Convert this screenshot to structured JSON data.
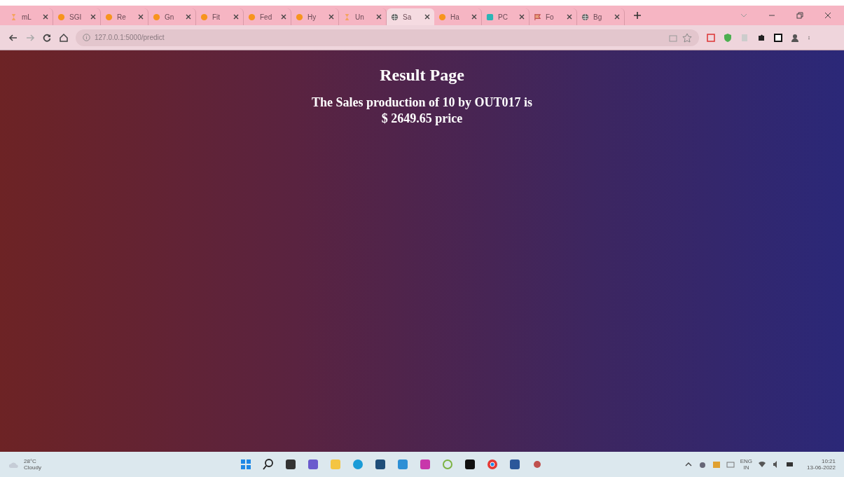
{
  "tabs": [
    {
      "label": "mL",
      "kind": "hourglass",
      "selected": false
    },
    {
      "label": "SGI",
      "kind": "dot",
      "selected": false
    },
    {
      "label": "Re",
      "kind": "dot",
      "selected": false
    },
    {
      "label": "Gn",
      "kind": "dot",
      "selected": false
    },
    {
      "label": "Fit",
      "kind": "dot",
      "selected": false
    },
    {
      "label": "Fed",
      "kind": "dot",
      "selected": false
    },
    {
      "label": "Hy",
      "kind": "dot",
      "selected": false
    },
    {
      "label": "Un",
      "kind": "hourglass",
      "selected": false
    },
    {
      "label": "Sa",
      "kind": "globe",
      "selected": true
    },
    {
      "label": "Ha",
      "kind": "dot",
      "selected": false
    },
    {
      "label": "PC",
      "kind": "square",
      "selected": false
    },
    {
      "label": "Fo",
      "kind": "flag",
      "selected": false
    },
    {
      "label": "Bg",
      "kind": "globe",
      "selected": false
    }
  ],
  "address_bar": {
    "url": "127.0.0.1:5000/predict"
  },
  "page": {
    "title": "Result Page",
    "result_lines": [
      "The Sales production of 10 by OUT017 is",
      "$ 2649.65 price"
    ]
  },
  "taskbar": {
    "weather": {
      "temperature": "28°C",
      "condition": "Cloudy"
    },
    "language": "ENG",
    "region": "IN",
    "time": "10:21",
    "date": "13-06-2022"
  }
}
